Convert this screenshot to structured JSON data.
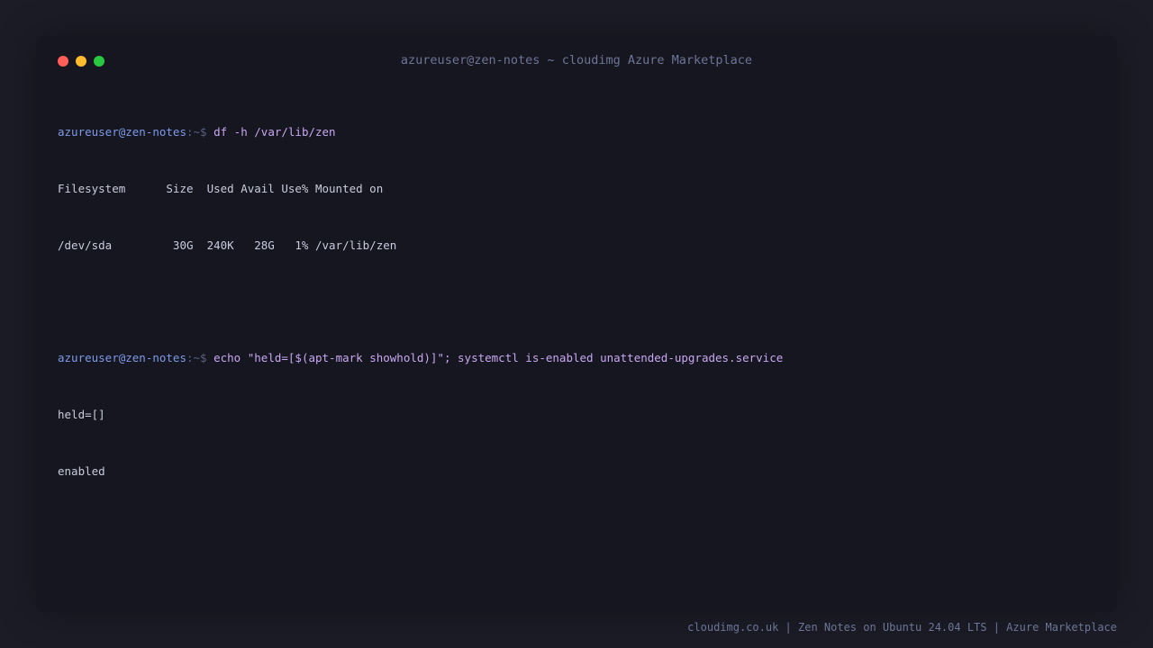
{
  "window": {
    "title": "azureuser@zen-notes ~ cloudimg Azure Marketplace",
    "controls": {
      "close_color": "#ff5f57",
      "minimize_color": "#febc2e",
      "maximize_color": "#28c840"
    }
  },
  "terminal": {
    "blocks": [
      {
        "prompt_user": "azureuser@zen-notes",
        "prompt_sep": ":~$",
        "command": "df -h /var/lib/zen",
        "output": [
          "Filesystem      Size  Used Avail Use% Mounted on",
          "/dev/sda         30G  240K   28G   1% /var/lib/zen"
        ]
      },
      {
        "prompt_user": "azureuser@zen-notes",
        "prompt_sep": ":~$",
        "command": "echo \"held=[$(apt-mark showhold)]\"; systemctl is-enabled unattended-upgrades.service",
        "output": [
          "held=[]",
          "enabled"
        ]
      }
    ]
  },
  "footer": {
    "text": "cloudimg.co.uk | Zen Notes on Ubuntu 24.04 LTS | Azure Marketplace"
  },
  "colors": {
    "background": "#1b1c26",
    "window_bg": "#151620",
    "prompt_user": "#7e9ae8",
    "command": "#c8a8f0",
    "output": "#c9ccdc",
    "muted": "#6e7595"
  }
}
